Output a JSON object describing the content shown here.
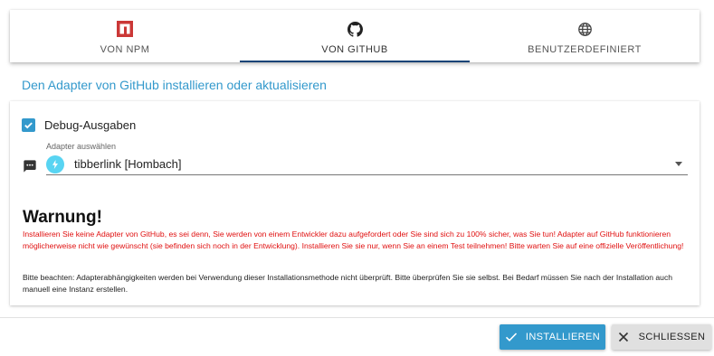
{
  "tabs": [
    {
      "label": "VON NPM",
      "icon": "npm-icon",
      "active": false
    },
    {
      "label": "VON GITHUB",
      "icon": "github-icon",
      "active": true
    },
    {
      "label": "BENUTZERDEFINIERT",
      "icon": "globe-icon",
      "active": false
    }
  ],
  "subtitle": "Den Adapter von GitHub installieren oder aktualisieren",
  "debug": {
    "label": "Debug-Ausgaben",
    "checked": true
  },
  "adapter_select": {
    "label": "Adapter auswählen",
    "value": "tibberlink [Hombach]"
  },
  "warning": {
    "title": "Warnung!",
    "text": "Installieren Sie keine Adapter von GitHub, es sei denn, Sie werden von einem Entwickler dazu aufgefordert oder Sie sind sich zu 100% sicher, was Sie tun! Adapter auf GitHub funktionieren möglicherweise nicht wie gewünscht (sie befinden sich noch in der Entwicklung). Installieren Sie sie nur, wenn Sie an einem Test teilnehmen! Bitte warten Sie auf eine offizielle Veröffentlichung!",
    "note": "Bitte beachten: Adapterabhängigkeiten werden bei Verwendung dieser Installationsmethode nicht überprüft. Bitte überprüfen Sie sie selbst. Bei Bedarf müssen Sie nach der Installation auch manuell eine Instanz erstellen."
  },
  "buttons": {
    "install": "INSTALLIEREN",
    "close": "SCHLIESSEN"
  },
  "colors": {
    "accent": "#3399cc",
    "tab_indicator": "#164477",
    "warning_text": "#e01010",
    "npm_red": "#cb3837"
  }
}
